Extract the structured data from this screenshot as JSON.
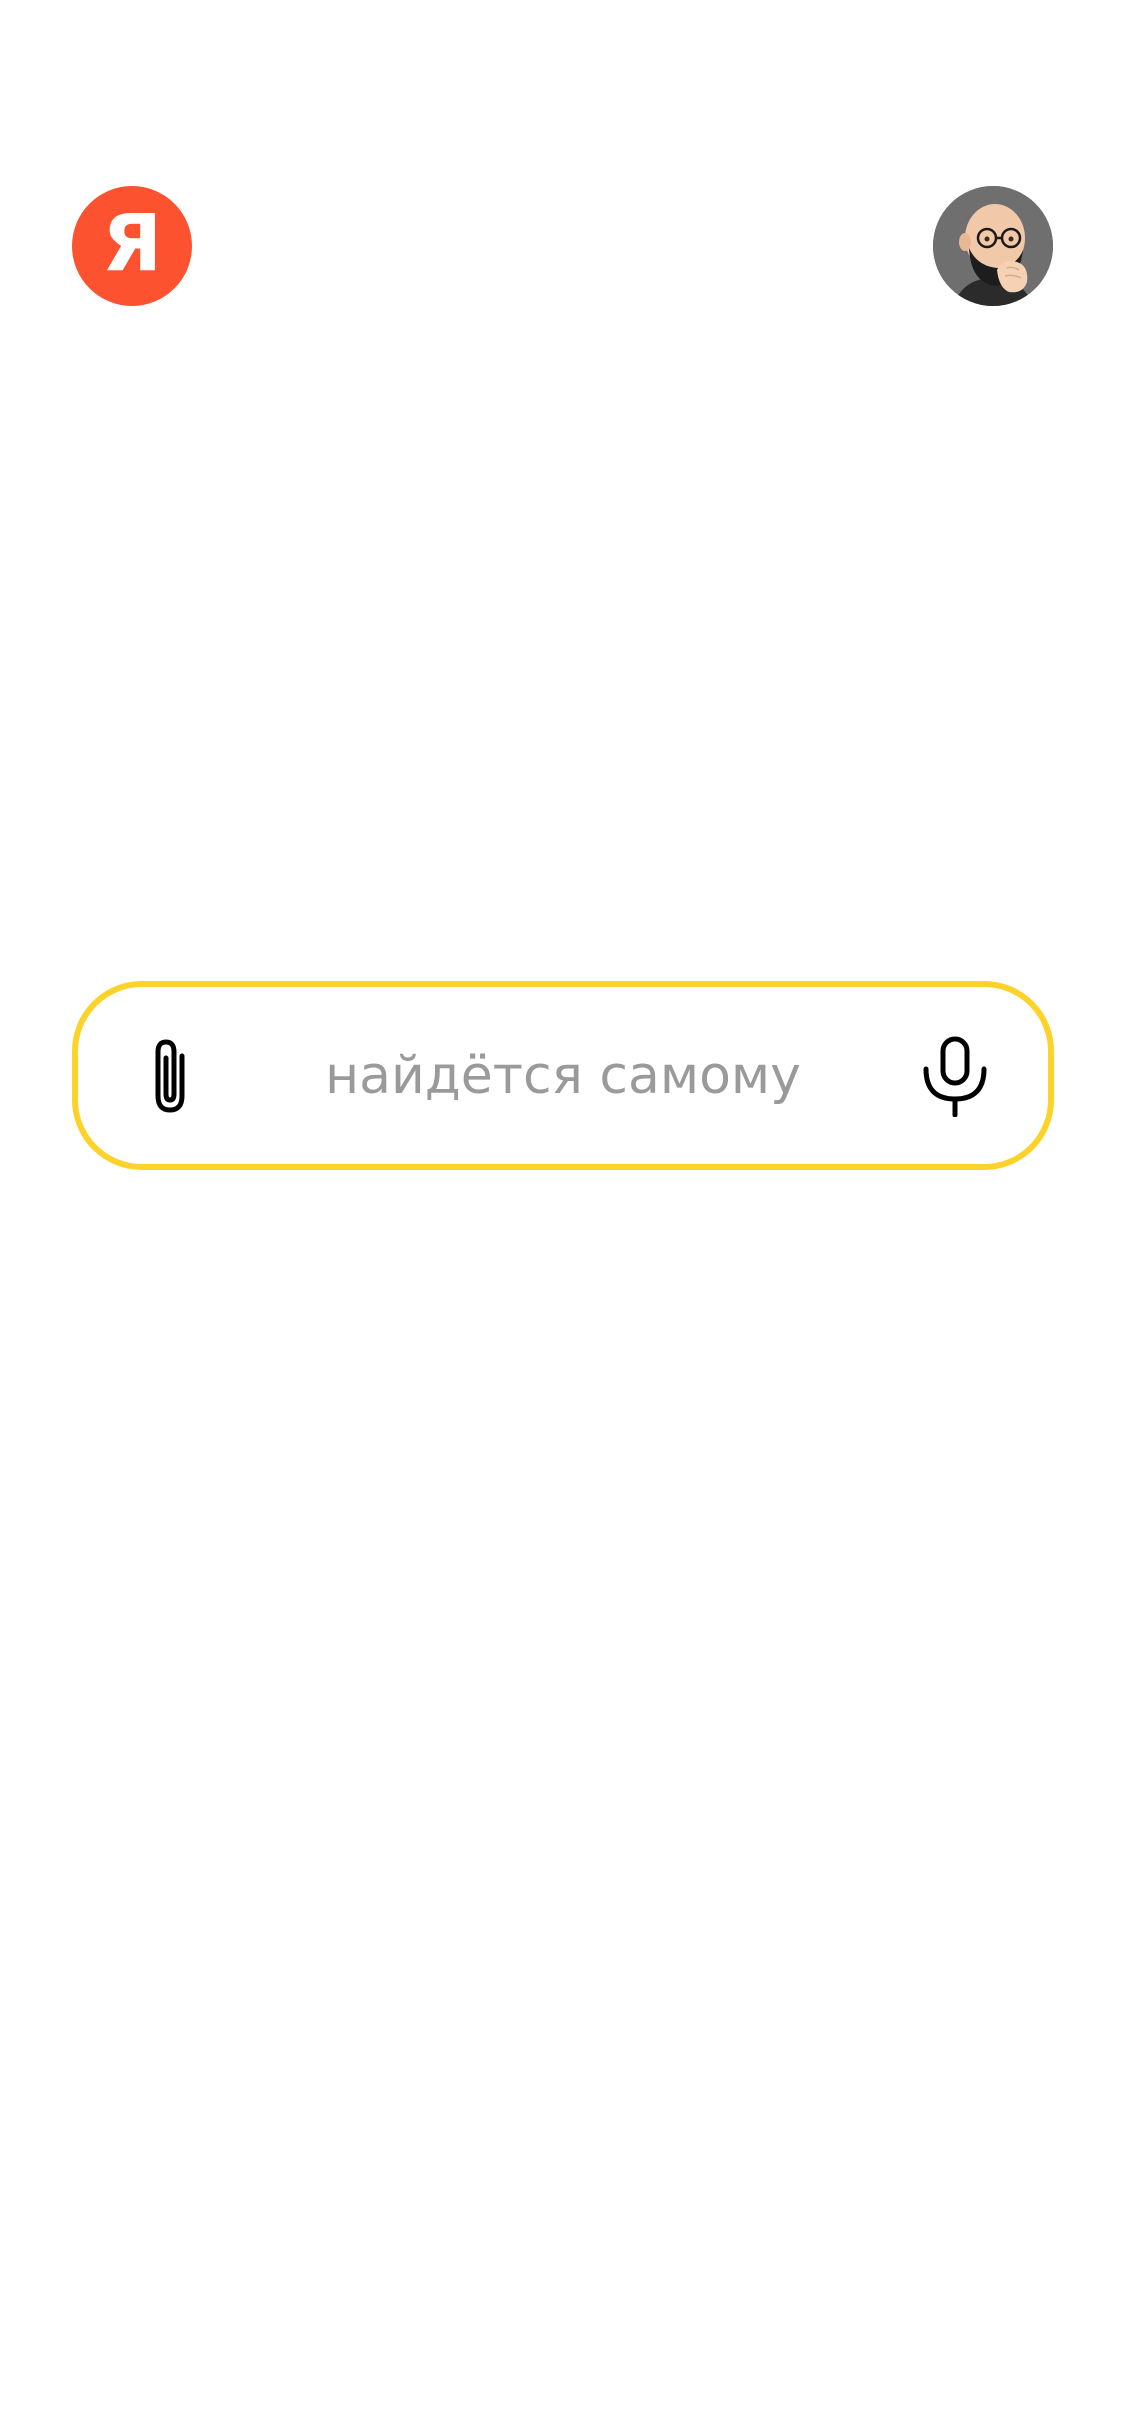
{
  "header": {
    "logo": {
      "letter": "Я",
      "icon": "yandex-logo",
      "color": "#fc5230"
    },
    "avatar": {
      "icon": "user-avatar-memoji",
      "background": "#6f6f6f"
    }
  },
  "search": {
    "placeholder": "найдётся самому",
    "border_color": "#fdd22a",
    "attach_icon": "paperclip-icon",
    "voice_icon": "microphone-icon"
  }
}
